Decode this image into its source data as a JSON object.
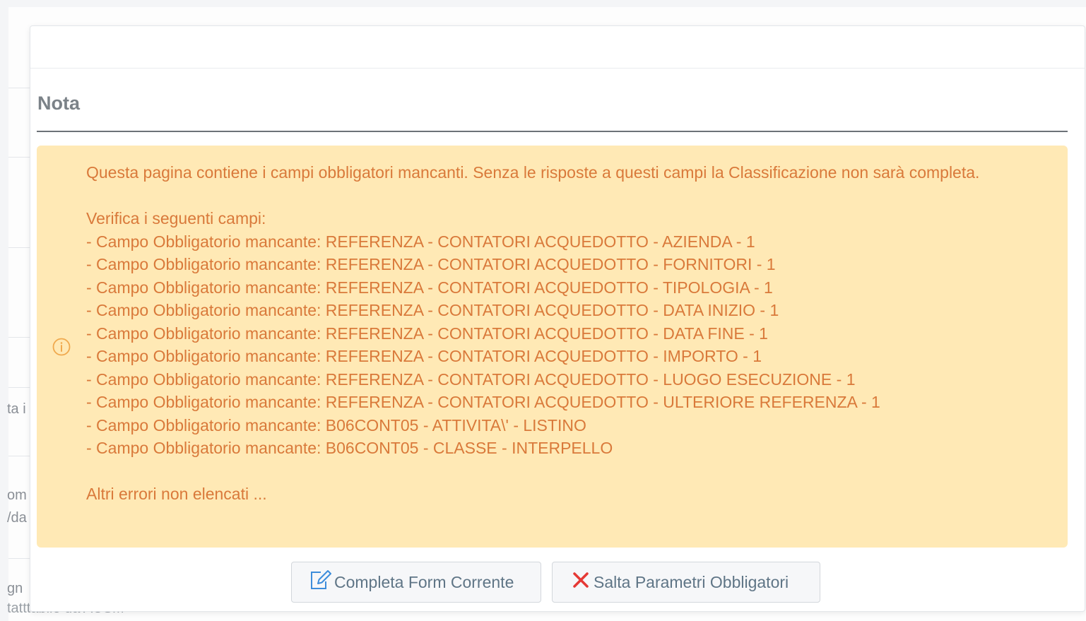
{
  "modal": {
    "title": "Nota",
    "alert": {
      "intro": "Questa pagina contiene i campi obbligatori mancanti. Senza le risposte a questi campi la Classificazione non sarà completa.",
      "check_heading": "Verifica i seguenti campi:",
      "fields": [
        "- Campo Obbligatorio mancante: REFERENZA - CONTATORI ACQUEDOTTO - AZIENDA - 1",
        "- Campo Obbligatorio mancante: REFERENZA - CONTATORI ACQUEDOTTO - FORNITORI - 1",
        "- Campo Obbligatorio mancante: REFERENZA - CONTATORI ACQUEDOTTO - TIPOLOGIA - 1",
        "- Campo Obbligatorio mancante: REFERENZA - CONTATORI ACQUEDOTTO - DATA INIZIO - 1",
        "- Campo Obbligatorio mancante: REFERENZA - CONTATORI ACQUEDOTTO - DATA FINE - 1",
        "- Campo Obbligatorio mancante: REFERENZA - CONTATORI ACQUEDOTTO - IMPORTO - 1",
        "- Campo Obbligatorio mancante: REFERENZA - CONTATORI ACQUEDOTTO - LUOGO ESECUZIONE - 1",
        "- Campo Obbligatorio mancante: REFERENZA - CONTATORI ACQUEDOTTO - ULTERIORE REFERENZA - 1",
        "- Campo Obbligatorio mancante: B06CONT05 - ATTIVITA\\' - LISTINO",
        "- Campo Obbligatorio mancante: B06CONT05 - CLASSE - INTERPELLO"
      ],
      "more_errors": "Altri errori non elencati ...",
      "icon": "info-circle-icon"
    },
    "buttons": {
      "complete_label": "Completa Form Corrente",
      "complete_icon": "edit-icon",
      "skip_label": "Salta Parametri Obbligatori",
      "skip_icon": "close-icon"
    }
  },
  "background": {
    "fragments": [
      "ta i",
      "om",
      "/da",
      "gn",
      "tatttabile da AUSM"
    ]
  },
  "colors": {
    "alert_background": "#ffe9b5",
    "alert_text": "#d9793a",
    "skip_icon": "#e53935",
    "button_text": "#5f7586",
    "title_text": "#7b8288"
  }
}
